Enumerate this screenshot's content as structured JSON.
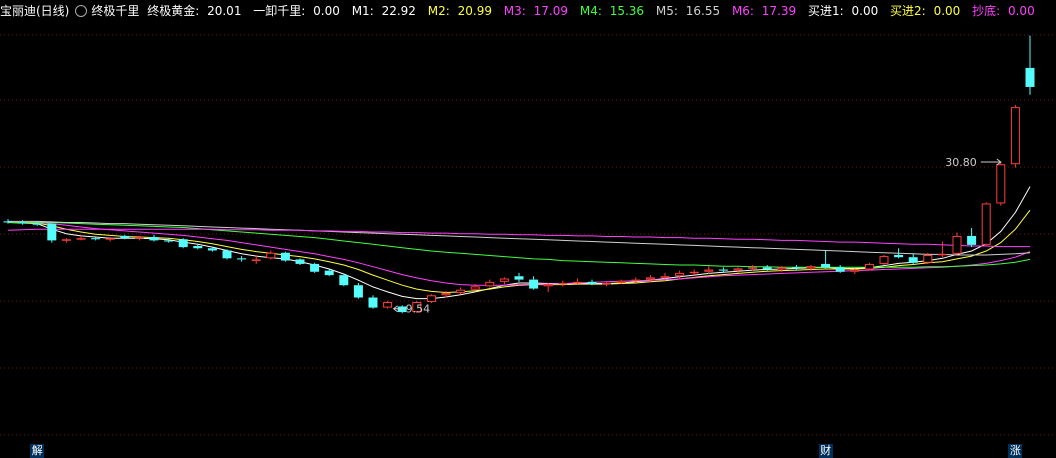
{
  "header": {
    "stock_name": "宝丽迪(日线)",
    "indicator_name": "终极千里",
    "fields": [
      {
        "label": "终极黄金:",
        "value": "20.01",
        "color": "#ffffff"
      },
      {
        "label": "一卸千里:",
        "value": "0.00",
        "color": "#ffffff"
      },
      {
        "label": "M1:",
        "value": "22.92",
        "color": "#ffffff"
      },
      {
        "label": "M2:",
        "value": "20.99",
        "color": "#ffff40"
      },
      {
        "label": "M3:",
        "value": "17.09",
        "color": "#ff40ff"
      },
      {
        "label": "M4:",
        "value": "15.36",
        "color": "#40ff40"
      },
      {
        "label": "M5:",
        "value": "16.55",
        "color": "#cfcfcf"
      },
      {
        "label": "M6:",
        "value": "17.39",
        "color": "#ff40ff"
      },
      {
        "label": "买进1:",
        "value": "0.00",
        "color": "#ffffff"
      },
      {
        "label": "买进2:",
        "value": "0.00",
        "color": "#ffff40"
      },
      {
        "label": "抄底:",
        "value": "0.00",
        "color": "#ff40ff"
      }
    ]
  },
  "chart_data": {
    "type": "candlestick",
    "price_range": [
      4.5,
      32.0
    ],
    "grid": "horizontal-dotted",
    "up_color": "#ff3c3c",
    "down_color": "#54fcfc",
    "annotations": [
      {
        "text": "30.80",
        "kind": "high",
        "index": 68
      },
      {
        "text": "9.54",
        "kind": "low",
        "index": 26
      }
    ],
    "candles": [
      [
        14.2,
        14.4,
        14.0,
        14.1
      ],
      [
        14.1,
        14.3,
        13.9,
        14.0
      ],
      [
        14.0,
        14.2,
        13.8,
        13.9
      ],
      [
        14.0,
        14.0,
        12.3,
        12.5
      ],
      [
        12.5,
        12.7,
        12.3,
        12.6
      ],
      [
        12.6,
        12.9,
        12.5,
        12.7
      ],
      [
        12.7,
        12.8,
        12.5,
        12.6
      ],
      [
        12.6,
        12.8,
        12.4,
        12.7
      ],
      [
        12.9,
        13.0,
        12.6,
        12.7
      ],
      [
        12.7,
        12.9,
        12.5,
        12.8
      ],
      [
        12.8,
        13.0,
        12.4,
        12.5
      ],
      [
        12.5,
        12.7,
        12.3,
        12.4
      ],
      [
        12.6,
        12.7,
        11.8,
        11.9
      ],
      [
        12.0,
        12.1,
        11.7,
        11.8
      ],
      [
        11.8,
        11.9,
        11.5,
        11.6
      ],
      [
        11.6,
        11.7,
        10.8,
        10.9
      ],
      [
        10.9,
        11.1,
        10.6,
        10.8
      ],
      [
        10.8,
        11.2,
        10.4,
        10.8
      ],
      [
        10.9,
        11.6,
        10.8,
        11.4
      ],
      [
        11.4,
        11.5,
        10.6,
        10.7
      ],
      [
        10.8,
        10.9,
        10.3,
        10.4
      ],
      [
        10.4,
        10.5,
        9.6,
        9.7
      ],
      [
        9.8,
        9.9,
        9.3,
        9.4
      ],
      [
        9.4,
        9.5,
        8.4,
        8.5
      ],
      [
        8.5,
        8.7,
        7.3,
        7.4
      ],
      [
        7.4,
        7.6,
        6.4,
        6.5
      ],
      [
        6.5,
        7.1,
        6.4,
        7.0
      ],
      [
        6.6,
        6.7,
        6.0,
        6.1
      ],
      [
        6.1,
        7.1,
        6.0,
        7.0
      ],
      [
        7.0,
        7.7,
        6.9,
        7.6
      ],
      [
        7.6,
        8.0,
        7.4,
        7.8
      ],
      [
        7.8,
        8.3,
        7.7,
        8.1
      ],
      [
        8.1,
        8.6,
        8.0,
        8.4
      ],
      [
        8.4,
        9.0,
        8.3,
        8.8
      ],
      [
        8.8,
        9.2,
        8.6,
        9.1
      ],
      [
        9.3,
        9.6,
        8.8,
        9.0
      ],
      [
        9.0,
        9.3,
        8.1,
        8.2
      ],
      [
        8.4,
        8.7,
        7.9,
        8.6
      ],
      [
        8.6,
        8.9,
        8.4,
        8.7
      ],
      [
        8.8,
        9.1,
        8.6,
        8.8
      ],
      [
        8.8,
        9.0,
        8.5,
        8.6
      ],
      [
        8.6,
        8.8,
        8.4,
        8.7
      ],
      [
        8.7,
        9.0,
        8.6,
        8.9
      ],
      [
        8.9,
        9.2,
        8.7,
        9.0
      ],
      [
        9.0,
        9.4,
        8.8,
        9.2
      ],
      [
        9.2,
        9.6,
        9.0,
        9.3
      ],
      [
        9.3,
        9.8,
        9.1,
        9.6
      ],
      [
        9.6,
        9.9,
        9.4,
        9.7
      ],
      [
        9.7,
        10.2,
        9.5,
        9.9
      ],
      [
        9.9,
        10.1,
        9.6,
        9.8
      ],
      [
        9.8,
        10.1,
        9.6,
        10.0
      ],
      [
        10.0,
        10.3,
        9.8,
        10.1
      ],
      [
        10.1,
        10.3,
        9.8,
        9.9
      ],
      [
        9.9,
        10.2,
        9.7,
        10.1
      ],
      [
        10.1,
        10.3,
        9.8,
        10.0
      ],
      [
        10.0,
        10.3,
        9.8,
        10.2
      ],
      [
        10.4,
        11.6,
        10.0,
        10.1
      ],
      [
        10.1,
        10.3,
        9.6,
        9.7
      ],
      [
        9.7,
        10.0,
        9.5,
        9.9
      ],
      [
        9.9,
        10.5,
        9.8,
        10.4
      ],
      [
        10.4,
        11.2,
        10.3,
        11.1
      ],
      [
        11.2,
        11.8,
        10.9,
        11.0
      ],
      [
        11.0,
        11.3,
        10.4,
        10.5
      ],
      [
        10.5,
        11.4,
        10.4,
        11.2
      ],
      [
        11.2,
        12.4,
        11.0,
        11.3
      ],
      [
        11.3,
        13.2,
        11.1,
        12.9
      ],
      [
        12.9,
        13.6,
        11.9,
        12.1
      ],
      [
        12.1,
        15.9,
        12.0,
        15.8
      ],
      [
        15.8,
        19.5,
        15.6,
        19.3
      ],
      [
        19.3,
        24.6,
        19.0,
        24.4
      ],
      [
        27.9,
        30.8,
        25.5,
        26.2
      ]
    ],
    "ma_lines": [
      {
        "name": "M1",
        "color": "#ffffff",
        "values": [
          14.1,
          14.05,
          14.0,
          13.5,
          13.1,
          12.9,
          12.8,
          12.7,
          12.7,
          12.7,
          12.65,
          12.55,
          12.35,
          12.15,
          11.9,
          11.6,
          11.3,
          11.1,
          10.95,
          10.85,
          10.6,
          10.3,
          9.95,
          9.5,
          8.95,
          8.35,
          7.9,
          7.5,
          7.3,
          7.3,
          7.45,
          7.65,
          7.9,
          8.2,
          8.5,
          8.7,
          8.7,
          8.65,
          8.65,
          8.65,
          8.65,
          8.65,
          8.7,
          8.8,
          8.95,
          9.1,
          9.25,
          9.4,
          9.55,
          9.65,
          9.75,
          9.85,
          9.9,
          9.95,
          10.0,
          10.05,
          10.1,
          10.0,
          10.0,
          10.05,
          10.25,
          10.45,
          10.55,
          10.7,
          10.9,
          11.25,
          11.55,
          12.2,
          13.3,
          15.0,
          17.3
        ]
      },
      {
        "name": "M2",
        "color": "#ffff40",
        "values": [
          14.1,
          14.08,
          14.05,
          13.8,
          13.5,
          13.25,
          13.05,
          12.95,
          12.85,
          12.8,
          12.75,
          12.7,
          12.55,
          12.4,
          12.2,
          11.95,
          11.7,
          11.5,
          11.35,
          11.2,
          11.05,
          10.85,
          10.6,
          10.3,
          9.9,
          9.4,
          8.95,
          8.5,
          8.15,
          7.95,
          7.85,
          7.9,
          8.0,
          8.15,
          8.35,
          8.5,
          8.55,
          8.55,
          8.55,
          8.6,
          8.6,
          8.6,
          8.65,
          8.7,
          8.8,
          8.9,
          9.05,
          9.2,
          9.35,
          9.45,
          9.55,
          9.65,
          9.75,
          9.8,
          9.85,
          9.9,
          9.95,
          9.95,
          9.95,
          10.0,
          10.1,
          10.25,
          10.35,
          10.5,
          10.6,
          10.85,
          11.1,
          11.55,
          12.3,
          13.5,
          15.2
        ]
      },
      {
        "name": "M3",
        "color": "#ff40ff",
        "values": [
          14.1,
          14.1,
          14.08,
          14.0,
          13.85,
          13.7,
          13.55,
          13.45,
          13.35,
          13.25,
          13.15,
          13.05,
          12.95,
          12.8,
          12.65,
          12.5,
          12.3,
          12.1,
          11.9,
          11.7,
          11.5,
          11.3,
          11.05,
          10.8,
          10.5,
          10.15,
          9.8,
          9.45,
          9.15,
          8.9,
          8.7,
          8.55,
          8.5,
          8.5,
          8.5,
          8.55,
          8.6,
          8.6,
          8.65,
          8.7,
          8.75,
          8.8,
          8.85,
          8.9,
          8.95,
          9.0,
          9.05,
          9.15,
          9.25,
          9.35,
          9.4,
          9.45,
          9.5,
          9.55,
          9.6,
          9.65,
          9.7,
          9.75,
          9.8,
          9.85,
          9.9,
          9.95,
          10.0,
          10.05,
          10.1,
          10.2,
          10.3,
          10.45,
          10.7,
          11.0,
          11.5
        ]
      },
      {
        "name": "M4",
        "color": "#40ff40",
        "values": [
          14.1,
          14.1,
          14.1,
          14.1,
          14.05,
          14.0,
          13.95,
          13.9,
          13.85,
          13.8,
          13.75,
          13.7,
          13.65,
          13.55,
          13.45,
          13.35,
          13.25,
          13.15,
          13.05,
          12.95,
          12.85,
          12.75,
          12.6,
          12.45,
          12.3,
          12.15,
          12.0,
          11.85,
          11.7,
          11.55,
          11.45,
          11.35,
          11.25,
          11.15,
          11.05,
          10.95,
          10.85,
          10.8,
          10.7,
          10.65,
          10.6,
          10.55,
          10.5,
          10.45,
          10.4,
          10.35,
          10.3,
          10.3,
          10.25,
          10.2,
          10.2,
          10.15,
          10.15,
          10.1,
          10.1,
          10.1,
          10.1,
          10.1,
          10.1,
          10.1,
          10.1,
          10.1,
          10.1,
          10.15,
          10.15,
          10.2,
          10.25,
          10.3,
          10.4,
          10.55,
          10.8
        ]
      },
      {
        "name": "M5",
        "color": "#cfcfcf",
        "values": [
          14.2,
          14.2,
          14.2,
          14.15,
          14.1,
          14.1,
          14.05,
          14.0,
          14.0,
          13.95,
          13.9,
          13.85,
          13.8,
          13.75,
          13.7,
          13.65,
          13.6,
          13.55,
          13.5,
          13.45,
          13.4,
          13.35,
          13.3,
          13.25,
          13.2,
          13.15,
          13.1,
          13.05,
          13.0,
          12.95,
          12.9,
          12.85,
          12.8,
          12.75,
          12.7,
          12.65,
          12.6,
          12.55,
          12.5,
          12.45,
          12.4,
          12.35,
          12.3,
          12.25,
          12.2,
          12.15,
          12.1,
          12.05,
          12.0,
          11.95,
          11.9,
          11.85,
          11.8,
          11.75,
          11.7,
          11.65,
          11.6,
          11.55,
          11.5,
          11.45,
          11.4,
          11.35,
          11.3,
          11.25,
          11.25,
          11.2,
          11.2,
          11.2,
          11.25,
          11.3,
          11.4
        ]
      },
      {
        "name": "M6",
        "color": "#ff40ff",
        "values": [
          13.4,
          13.45,
          13.5,
          13.5,
          13.5,
          13.5,
          13.5,
          13.5,
          13.5,
          13.5,
          13.5,
          13.5,
          13.5,
          13.5,
          13.5,
          13.45,
          13.45,
          13.45,
          13.4,
          13.4,
          13.4,
          13.35,
          13.35,
          13.3,
          13.3,
          13.25,
          13.25,
          13.2,
          13.2,
          13.15,
          13.15,
          13.1,
          13.1,
          13.05,
          13.05,
          13.0,
          13.0,
          12.95,
          12.95,
          12.9,
          12.9,
          12.85,
          12.85,
          12.8,
          12.8,
          12.75,
          12.75,
          12.7,
          12.7,
          12.65,
          12.6,
          12.6,
          12.55,
          12.5,
          12.5,
          12.45,
          12.4,
          12.35,
          12.35,
          12.3,
          12.25,
          12.2,
          12.15,
          12.15,
          12.1,
          12.05,
          12.0,
          12.0,
          11.95,
          11.95,
          11.95
        ]
      }
    ]
  },
  "badges": [
    {
      "text": "解",
      "index": 2
    },
    {
      "text": "财",
      "index": 56
    },
    {
      "text": "涨",
      "index": 69
    }
  ]
}
